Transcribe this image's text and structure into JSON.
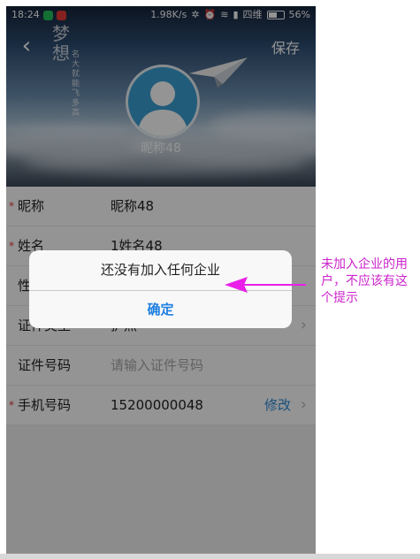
{
  "status_bar": {
    "time": "18:24",
    "speed": "1.98K/s",
    "carrier": "四维",
    "battery": "56%"
  },
  "header": {
    "back_icon": "‹",
    "save_label": "保存",
    "nickname": "昵称48"
  },
  "form": {
    "rows": [
      {
        "label": "昵称",
        "value": "昵称48",
        "required": true
      },
      {
        "label": "姓名",
        "value": "1姓名48",
        "required": true
      },
      {
        "label": "性别",
        "value": "",
        "required": false
      },
      {
        "label": "证件类型",
        "value": "护照",
        "required": false
      },
      {
        "label": "证件号码",
        "placeholder": "请输入证件号码",
        "required": false
      },
      {
        "label": "手机号码",
        "value": "15200000048",
        "action": "修改",
        "required": true
      }
    ]
  },
  "dialog": {
    "message": "还没有加入任何企业",
    "confirm_label": "确定"
  },
  "annotation": {
    "text": "未加入企业的用户，不应该有这个提示",
    "color": "#cc22cc"
  },
  "colors": {
    "accent": "#1e7fe0",
    "required": "#e53935",
    "avatar_bg": "#3a9fd3"
  }
}
